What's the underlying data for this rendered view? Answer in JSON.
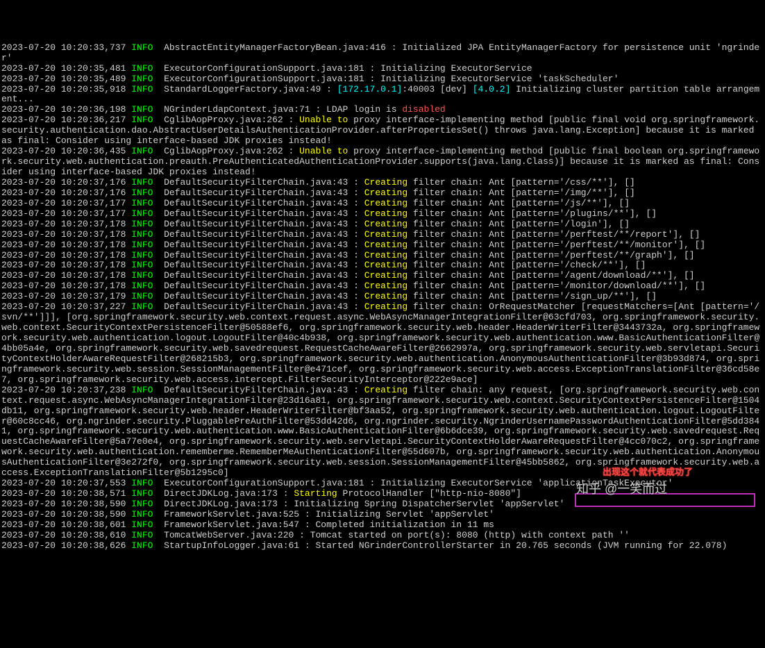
{
  "annotation": {
    "callout_text": "出现这个就代表成功了",
    "watermark": "知乎 @一笑而过"
  },
  "lines": [
    {
      "ts": "2023-07-20 10:20:33,737",
      "level": "INFO",
      "seg": [
        {
          "c": "txt",
          "t": "  AbstractEntityManagerFactoryBean.java:416 : Initialized JPA EntityManagerFactory for persistence unit 'ngrinder'"
        }
      ]
    },
    {
      "ts": "2023-07-20 10:20:35,481",
      "level": "INFO",
      "seg": [
        {
          "c": "txt",
          "t": "  ExecutorConfigurationSupport.java:181 : Initializing ExecutorService"
        }
      ]
    },
    {
      "ts": "2023-07-20 10:20:35,489",
      "level": "INFO",
      "seg": [
        {
          "c": "txt",
          "t": "  ExecutorConfigurationSupport.java:181 : Initializing ExecutorService 'taskScheduler'"
        }
      ]
    },
    {
      "ts": "2023-07-20 10:20:35,918",
      "level": "INFO",
      "seg": [
        {
          "c": "txt",
          "t": "  StandardLoggerFactory.java:49 : "
        },
        {
          "c": "highlight-cyan",
          "t": "[172.17.0.1]"
        },
        {
          "c": "txt",
          "t": ":40003 [dev] "
        },
        {
          "c": "highlight-cyan",
          "t": "[4.0.2]"
        },
        {
          "c": "txt",
          "t": " Initializing cluster partition table arrangement..."
        }
      ]
    },
    {
      "ts": "2023-07-20 10:20:36,198",
      "level": "INFO",
      "seg": [
        {
          "c": "txt",
          "t": "  NGrinderLdapContext.java:71 : LDAP login is "
        },
        {
          "c": "highlight-red",
          "t": "disabled"
        }
      ]
    },
    {
      "ts": "2023-07-20 10:20:36,217",
      "level": "INFO",
      "seg": [
        {
          "c": "txt",
          "t": "  CglibAopProxy.java:262 : "
        },
        {
          "c": "highlight-yellow",
          "t": "Unable to"
        },
        {
          "c": "txt",
          "t": " proxy interface-implementing method [public final void org.springframework.security.authentication.dao.AbstractUserDetailsAuthenticationProvider.afterPropertiesSet() throws java.lang.Exception] because it is marked as final: Consider using interface-based JDK proxies instead!"
        }
      ]
    },
    {
      "ts": "2023-07-20 10:20:36,435",
      "level": "INFO",
      "seg": [
        {
          "c": "txt",
          "t": "  CglibAopProxy.java:262 : "
        },
        {
          "c": "highlight-yellow",
          "t": "Unable to"
        },
        {
          "c": "txt",
          "t": " proxy interface-implementing method [public final boolean org.springframework.security.web.authentication.preauth.PreAuthenticatedAuthenticationProvider.supports(java.lang.Class)] because it is marked as final: Consider using interface-based JDK proxies instead!"
        }
      ]
    },
    {
      "ts": "2023-07-20 10:20:37,176",
      "level": "INFO",
      "seg": [
        {
          "c": "txt",
          "t": "  DefaultSecurityFilterChain.java:43 : "
        },
        {
          "c": "highlight-yellow",
          "t": "Creating"
        },
        {
          "c": "txt",
          "t": " filter chain: Ant [pattern='/css/**'], []"
        }
      ]
    },
    {
      "ts": "2023-07-20 10:20:37,176",
      "level": "INFO",
      "seg": [
        {
          "c": "txt",
          "t": "  DefaultSecurityFilterChain.java:43 : "
        },
        {
          "c": "highlight-yellow",
          "t": "Creating"
        },
        {
          "c": "txt",
          "t": " filter chain: Ant [pattern='/img/**'], []"
        }
      ]
    },
    {
      "ts": "2023-07-20 10:20:37,177",
      "level": "INFO",
      "seg": [
        {
          "c": "txt",
          "t": "  DefaultSecurityFilterChain.java:43 : "
        },
        {
          "c": "highlight-yellow",
          "t": "Creating"
        },
        {
          "c": "txt",
          "t": " filter chain: Ant [pattern='/js/**'], []"
        }
      ]
    },
    {
      "ts": "2023-07-20 10:20:37,177",
      "level": "INFO",
      "seg": [
        {
          "c": "txt",
          "t": "  DefaultSecurityFilterChain.java:43 : "
        },
        {
          "c": "highlight-yellow",
          "t": "Creating"
        },
        {
          "c": "txt",
          "t": " filter chain: Ant [pattern='/plugins/**'], []"
        }
      ]
    },
    {
      "ts": "2023-07-20 10:20:37,178",
      "level": "INFO",
      "seg": [
        {
          "c": "txt",
          "t": "  DefaultSecurityFilterChain.java:43 : "
        },
        {
          "c": "highlight-yellow",
          "t": "Creating"
        },
        {
          "c": "txt",
          "t": " filter chain: Ant [pattern='/login'], []"
        }
      ]
    },
    {
      "ts": "2023-07-20 10:20:37,178",
      "level": "INFO",
      "seg": [
        {
          "c": "txt",
          "t": "  DefaultSecurityFilterChain.java:43 : "
        },
        {
          "c": "highlight-yellow",
          "t": "Creating"
        },
        {
          "c": "txt",
          "t": " filter chain: Ant [pattern='/perftest/**/report'], []"
        }
      ]
    },
    {
      "ts": "2023-07-20 10:20:37,178",
      "level": "INFO",
      "seg": [
        {
          "c": "txt",
          "t": "  DefaultSecurityFilterChain.java:43 : "
        },
        {
          "c": "highlight-yellow",
          "t": "Creating"
        },
        {
          "c": "txt",
          "t": " filter chain: Ant [pattern='/perftest/**/monitor'], []"
        }
      ]
    },
    {
      "ts": "2023-07-20 10:20:37,178",
      "level": "INFO",
      "seg": [
        {
          "c": "txt",
          "t": "  DefaultSecurityFilterChain.java:43 : "
        },
        {
          "c": "highlight-yellow",
          "t": "Creating"
        },
        {
          "c": "txt",
          "t": " filter chain: Ant [pattern='/perftest/**/graph'], []"
        }
      ]
    },
    {
      "ts": "2023-07-20 10:20:37,178",
      "level": "INFO",
      "seg": [
        {
          "c": "txt",
          "t": "  DefaultSecurityFilterChain.java:43 : "
        },
        {
          "c": "highlight-yellow",
          "t": "Creating"
        },
        {
          "c": "txt",
          "t": " filter chain: Ant [pattern='/check/**'], []"
        }
      ]
    },
    {
      "ts": "2023-07-20 10:20:37,178",
      "level": "INFO",
      "seg": [
        {
          "c": "txt",
          "t": "  DefaultSecurityFilterChain.java:43 : "
        },
        {
          "c": "highlight-yellow",
          "t": "Creating"
        },
        {
          "c": "txt",
          "t": " filter chain: Ant [pattern='/agent/download/**'], []"
        }
      ]
    },
    {
      "ts": "2023-07-20 10:20:37,178",
      "level": "INFO",
      "seg": [
        {
          "c": "txt",
          "t": "  DefaultSecurityFilterChain.java:43 : "
        },
        {
          "c": "highlight-yellow",
          "t": "Creating"
        },
        {
          "c": "txt",
          "t": " filter chain: Ant [pattern='/monitor/download/**'], []"
        }
      ]
    },
    {
      "ts": "2023-07-20 10:20:37,179",
      "level": "INFO",
      "seg": [
        {
          "c": "txt",
          "t": "  DefaultSecurityFilterChain.java:43 : "
        },
        {
          "c": "highlight-yellow",
          "t": "Creating"
        },
        {
          "c": "txt",
          "t": " filter chain: Ant [pattern='/sign_up/**'], []"
        }
      ]
    },
    {
      "ts": "2023-07-20 10:20:37,227",
      "level": "INFO",
      "seg": [
        {
          "c": "txt",
          "t": "  DefaultSecurityFilterChain.java:43 : "
        },
        {
          "c": "highlight-yellow",
          "t": "Creating"
        },
        {
          "c": "txt",
          "t": " filter chain: OrRequestMatcher [requestMatchers=[Ant [pattern='/svn/**']]], [org.springframework.security.web.context.request.async.WebAsyncManagerIntegrationFilter@63cfd703, org.springframework.security.web.context.SecurityContextPersistenceFilter@50588ef6, org.springframework.security.web.header.HeaderWriterFilter@3443732a, org.springframework.security.web.authentication.logout.LogoutFilter@40c4b938, org.springframework.security.web.authentication.www.BasicAuthenticationFilter@4bb05a4e, org.springframework.security.web.savedrequest.RequestCacheAwareFilter@2662997a, org.springframework.security.web.servletapi.SecurityContextHolderAwareRequestFilter@268215b3, org.springframework.security.web.authentication.AnonymousAuthenticationFilter@3b93d874, org.springframework.security.web.session.SessionManagementFilter@e471cef, org.springframework.security.web.access.ExceptionTranslationFilter@36cd58e7, org.springframework.security.web.access.intercept.FilterSecurityInterceptor@222e9ace]"
        }
      ]
    },
    {
      "ts": "2023-07-20 10:20:37,238",
      "level": "INFO",
      "seg": [
        {
          "c": "txt",
          "t": "  DefaultSecurityFilterChain.java:43 : "
        },
        {
          "c": "highlight-yellow",
          "t": "Creating"
        },
        {
          "c": "txt",
          "t": " filter chain: any request, [org.springframework.security.web.context.request.async.WebAsyncManagerIntegrationFilter@23d16a81, org.springframework.security.web.context.SecurityContextPersistenceFilter@1504db11, org.springframework.security.web.header.HeaderWriterFilter@bf3aa52, org.springframework.security.web.authentication.logout.LogoutFilter@60c8cc46, org.ngrinder.security.PluggablePreAuthFilter@53dd42d6, org.ngrinder.security.NgrinderUsernamePasswordAuthenticationFilter@5dd3841, org.springframework.security.web.authentication.www.BasicAuthenticationFilter@6b6dce39, org.springframework.security.web.savedrequest.RequestCacheAwareFilter@5a77e0e4, org.springframework.security.web.servletapi.SecurityContextHolderAwareRequestFilter@4cc070c2, org.springframework.security.web.authentication.rememberme.RememberMeAuthenticationFilter@55d607b, org.springframework.security.web.authentication.AnonymousAuthenticationFilter@3e272f0, org.springframework.security.web.session.SessionManagementFilter@45bb5862, org.springframework.security.web.access.ExceptionTranslationFilter@5b1295c0]"
        }
      ]
    },
    {
      "ts": "2023-07-20 10:20:37,553",
      "level": "INFO",
      "seg": [
        {
          "c": "txt",
          "t": "  ExecutorConfigurationSupport.java:181 : Initializing ExecutorService 'applicationTaskExecutor'"
        }
      ]
    },
    {
      "ts": "2023-07-20 10:20:38,571",
      "level": "INFO",
      "seg": [
        {
          "c": "txt",
          "t": "  DirectJDKLog.java:173 : "
        },
        {
          "c": "highlight-yellow",
          "t": "Starting"
        },
        {
          "c": "txt",
          "t": " ProtocolHandler [\"http-nio-8080\"]"
        }
      ]
    },
    {
      "ts": "2023-07-20 10:20:38,590",
      "level": "INFO",
      "seg": [
        {
          "c": "txt",
          "t": "  DirectJDKLog.java:173 : Initializing Spring DispatcherServlet 'appServlet'"
        }
      ]
    },
    {
      "ts": "2023-07-20 10:20:38,590",
      "level": "INFO",
      "seg": [
        {
          "c": "txt",
          "t": "  FrameworkServlet.java:525 : Initializing Servlet 'appServlet'"
        }
      ]
    },
    {
      "ts": "2023-07-20 10:20:38,601",
      "level": "INFO",
      "seg": [
        {
          "c": "txt",
          "t": "  FrameworkServlet.java:547 : Completed initialization in 11 ms"
        }
      ]
    },
    {
      "ts": "2023-07-20 10:20:38,610",
      "level": "INFO",
      "seg": [
        {
          "c": "txt",
          "t": "  TomcatWebServer.java:220 : Tomcat started on port(s): 8080 (http) with context path ''"
        }
      ]
    },
    {
      "ts": "2023-07-20 10:20:38,626",
      "level": "INFO",
      "seg": [
        {
          "c": "txt",
          "t": "  StartupInfoLogger.java:61 : Started NGrinderControllerStarter in 20.765 seconds (JVM running for 22.078)"
        }
      ]
    }
  ]
}
